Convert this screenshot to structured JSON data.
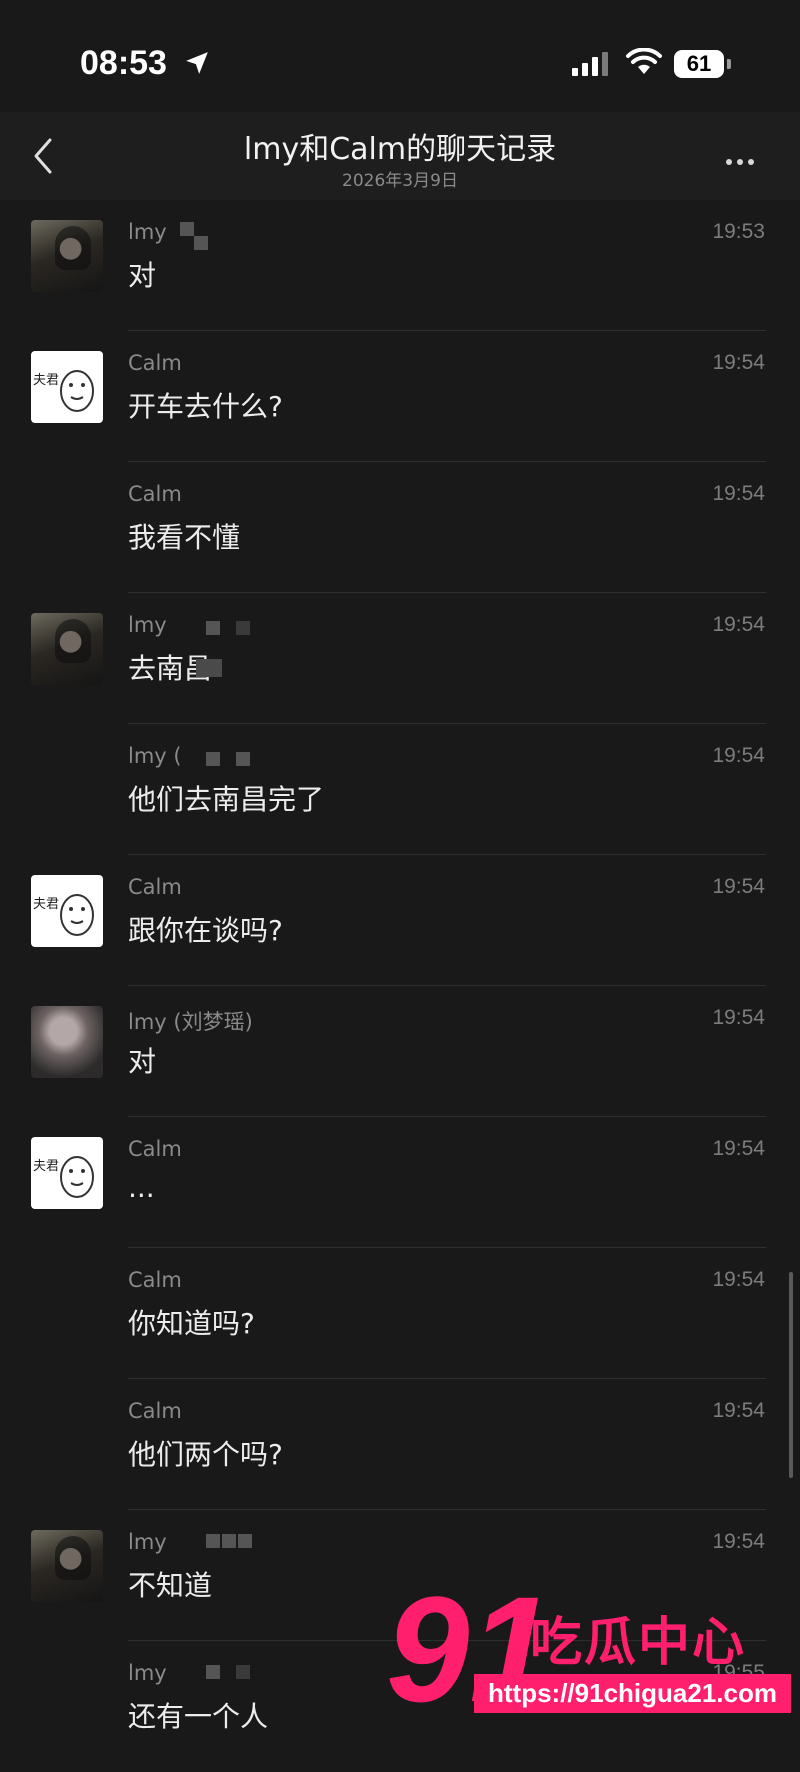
{
  "status_bar": {
    "time": "08:53",
    "battery": "61"
  },
  "nav": {
    "title": "lmy和Calm的聊天记录",
    "subtitle": "2026年3月9日"
  },
  "messages": [
    {
      "sender": "lmy",
      "time": "19:53",
      "text": "对"
    },
    {
      "sender": "Calm",
      "time": "19:54",
      "text": "开车去什么?"
    },
    {
      "sender": "Calm",
      "time": "19:54",
      "text": "我看不懂"
    },
    {
      "sender": "lmy",
      "time": "19:54",
      "text": "去南昌"
    },
    {
      "sender": "lmy (",
      "time": "19:54",
      "text": "他们去南昌完了"
    },
    {
      "sender": "Calm",
      "time": "19:54",
      "text": "跟你在谈吗?"
    },
    {
      "sender": "lmy (刘梦瑶)",
      "time": "19:54",
      "text": "对"
    },
    {
      "sender": "Calm",
      "time": "19:54",
      "text": "..."
    },
    {
      "sender": "Calm",
      "time": "19:54",
      "text": "你知道吗?"
    },
    {
      "sender": "Calm",
      "time": "19:54",
      "text": "他们两个吗?"
    },
    {
      "sender": "lmy",
      "time": "19:54",
      "text": "不知道"
    },
    {
      "sender": "lmy",
      "time": "19:55",
      "text": "还有一个人"
    }
  ],
  "avatar_label": "夫君",
  "watermark": {
    "number": "91",
    "name": "吃瓜中心",
    "url": "https://91chigua21.com"
  }
}
